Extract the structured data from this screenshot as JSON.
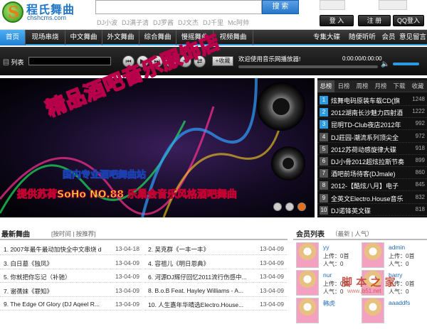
{
  "brand": {
    "name_cn": "程氏舞曲",
    "domain": "chshcms.com",
    "logo_letter": "S"
  },
  "search": {
    "button": "搜 索",
    "placeholder": "",
    "hot_words": [
      "DJ小波",
      "DJ满子清",
      "DJ罗酱",
      "DJ文杰",
      "DJ千里",
      "Mc阿帅"
    ]
  },
  "auth": {
    "login": "登 入",
    "register": "注 册",
    "qq_login": "QQ登入"
  },
  "nav": {
    "items": [
      "首页",
      "现场串烧",
      "中文舞曲",
      "外文舞曲",
      "综合舞曲",
      "慢摇舞曲",
      "视频舞曲"
    ],
    "right": [
      "专集大碟",
      "随便听听",
      "会员",
      "意见留言"
    ],
    "active": 0
  },
  "player": {
    "playlist_label": "列表",
    "fav": "收藏",
    "now_playing": "欢迎使用音乐网播放器!",
    "time": "0:00:00/0:00:00",
    "volume": 0.85,
    "progress": 0
  },
  "banner": {
    "title": "精品酒吧音乐服饰店",
    "sub": "国内专业酒吧舞曲站",
    "desc": "提供苏荷SoHo NO.88 乐巢会音乐风格酒吧舞曲",
    "slides": 3,
    "active_slide": 2
  },
  "ranking": {
    "tabs": [
      "总榜",
      "日榜",
      "周榜",
      "月榜",
      "下载",
      "收藏"
    ],
    "active": 0,
    "items": [
      {
        "n": "1",
        "title": "炫舞电码原装车载CD(旗",
        "count": "1248"
      },
      {
        "n": "2",
        "title": "2012湖南长沙魅力四射酒",
        "count": "1222"
      },
      {
        "n": "3",
        "title": "昆明TD-Club夜店2012年",
        "count": "992"
      },
      {
        "n": "4",
        "title": "DJ莊园-潮流系列顶尖全",
        "count": "972"
      },
      {
        "n": "5",
        "title": "2012苏荷动感旋律大碟",
        "count": "918"
      },
      {
        "n": "6",
        "title": "DJ小骨2012超炫拉斯节奏",
        "count": "899"
      },
      {
        "n": "7",
        "title": "酒吧前场待客(DJmale)",
        "count": "860"
      },
      {
        "n": "8",
        "title": "2012-【酷炫八月】电子",
        "count": "845"
      },
      {
        "n": "9",
        "title": "全英文Electro.House音乐",
        "count": "832"
      },
      {
        "n": "10",
        "title": "DJ诺锋英文碟",
        "count": "818"
      }
    ]
  },
  "new_songs": {
    "title": "最新舞曲",
    "sort": "[按时间 | 按推荐]",
    "left": [
      {
        "title": "1. 2007年最牛最动加快全中文串烧 d...",
        "date": "13-04-18"
      },
      {
        "title": "3. 白日墓《独凤》",
        "date": "13-04-09"
      },
      {
        "title": "5. 你就把你忘记（补驰）",
        "date": "13-04-09"
      },
      {
        "title": "7. 谢蒨妹《罪知》",
        "date": "13-04-09"
      },
      {
        "title": "9. The Edge Of Glory (DJ Aqeel R...",
        "date": "13-04-09"
      }
    ],
    "right": [
      {
        "title": "2. 吴克群《一丰一丰》",
        "date": "13-04-09"
      },
      {
        "title": "4. 容祖儿《明日恩典》",
        "date": "13-04-09"
      },
      {
        "title": "6. 河源DJ辉仔回忆2011流行伤感中...",
        "date": "13-04-09"
      },
      {
        "title": "8. B.o.B Feat. Hayley Williams - A...",
        "date": "13-04-09"
      },
      {
        "title": "10. 人生嘉年华晴选Electro.House...",
        "date": "13-04-09"
      }
    ]
  },
  "members": {
    "title": "会员列表",
    "tabs": "（最新 | 人气）",
    "list": [
      {
        "name": "yy",
        "up": "上传：0首",
        "fan": "人气：0"
      },
      {
        "name": "admin",
        "up": "上传：0首",
        "fan": "人气：0"
      },
      {
        "name": "nur",
        "up": "上传：0首",
        "fan": "人气：0"
      },
      {
        "name": "harry",
        "up": "上传：0首",
        "fan": "人气：0"
      },
      {
        "name": "韩虎",
        "up": "",
        "fan": ""
      },
      {
        "name": "aaaddfs",
        "up": "",
        "fan": ""
      }
    ]
  },
  "watermark": {
    "text": "脚 本 之 家",
    "url": "www.jb51.net"
  },
  "colors": {
    "accent": "#2d9be0",
    "nav_bg": "#1a1a1a",
    "rank_bg": "#111111"
  }
}
